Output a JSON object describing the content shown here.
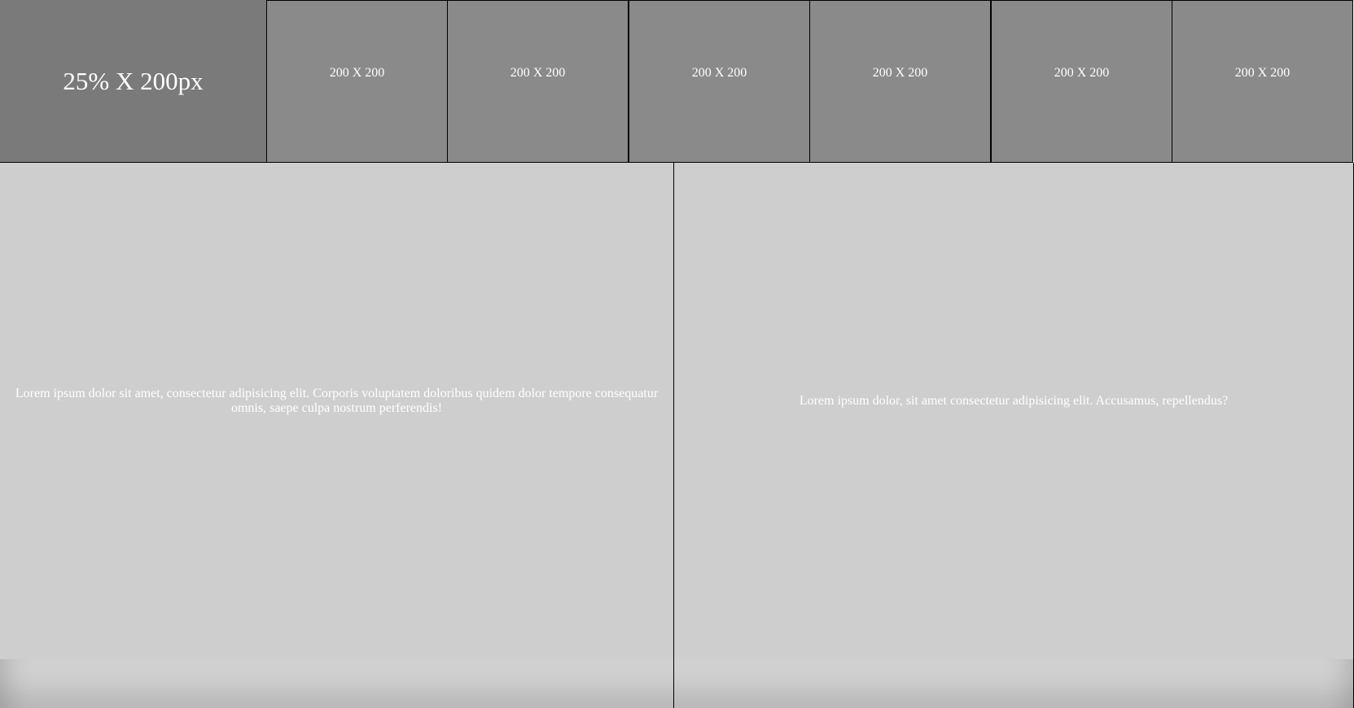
{
  "top_row": {
    "hero_label": "25% X 200px",
    "boxes": [
      {
        "label": "200 X 200"
      },
      {
        "label": "200 X 200"
      },
      {
        "label": "200 X 200"
      },
      {
        "label": "200 X 200"
      },
      {
        "label": "200 X 200"
      },
      {
        "label": "200 X 200"
      }
    ]
  },
  "panels": {
    "left_text": "Lorem ipsum dolor sit amet, consectetur adipisicing elit. Corporis voluptatem doloribus quidem dolor tempore consequatur omnis, saepe culpa nostrum perferendis!",
    "right_text": "Lorem ipsum dolor, sit amet consectetur adipisicing elit. Accusamus, repellendus?"
  },
  "colors": {
    "hero_bg": "#7a7a7a",
    "box_bg": "#8a8a8a",
    "panel_bg": "#cecece",
    "border": "#000000",
    "text": "#ffffff"
  }
}
